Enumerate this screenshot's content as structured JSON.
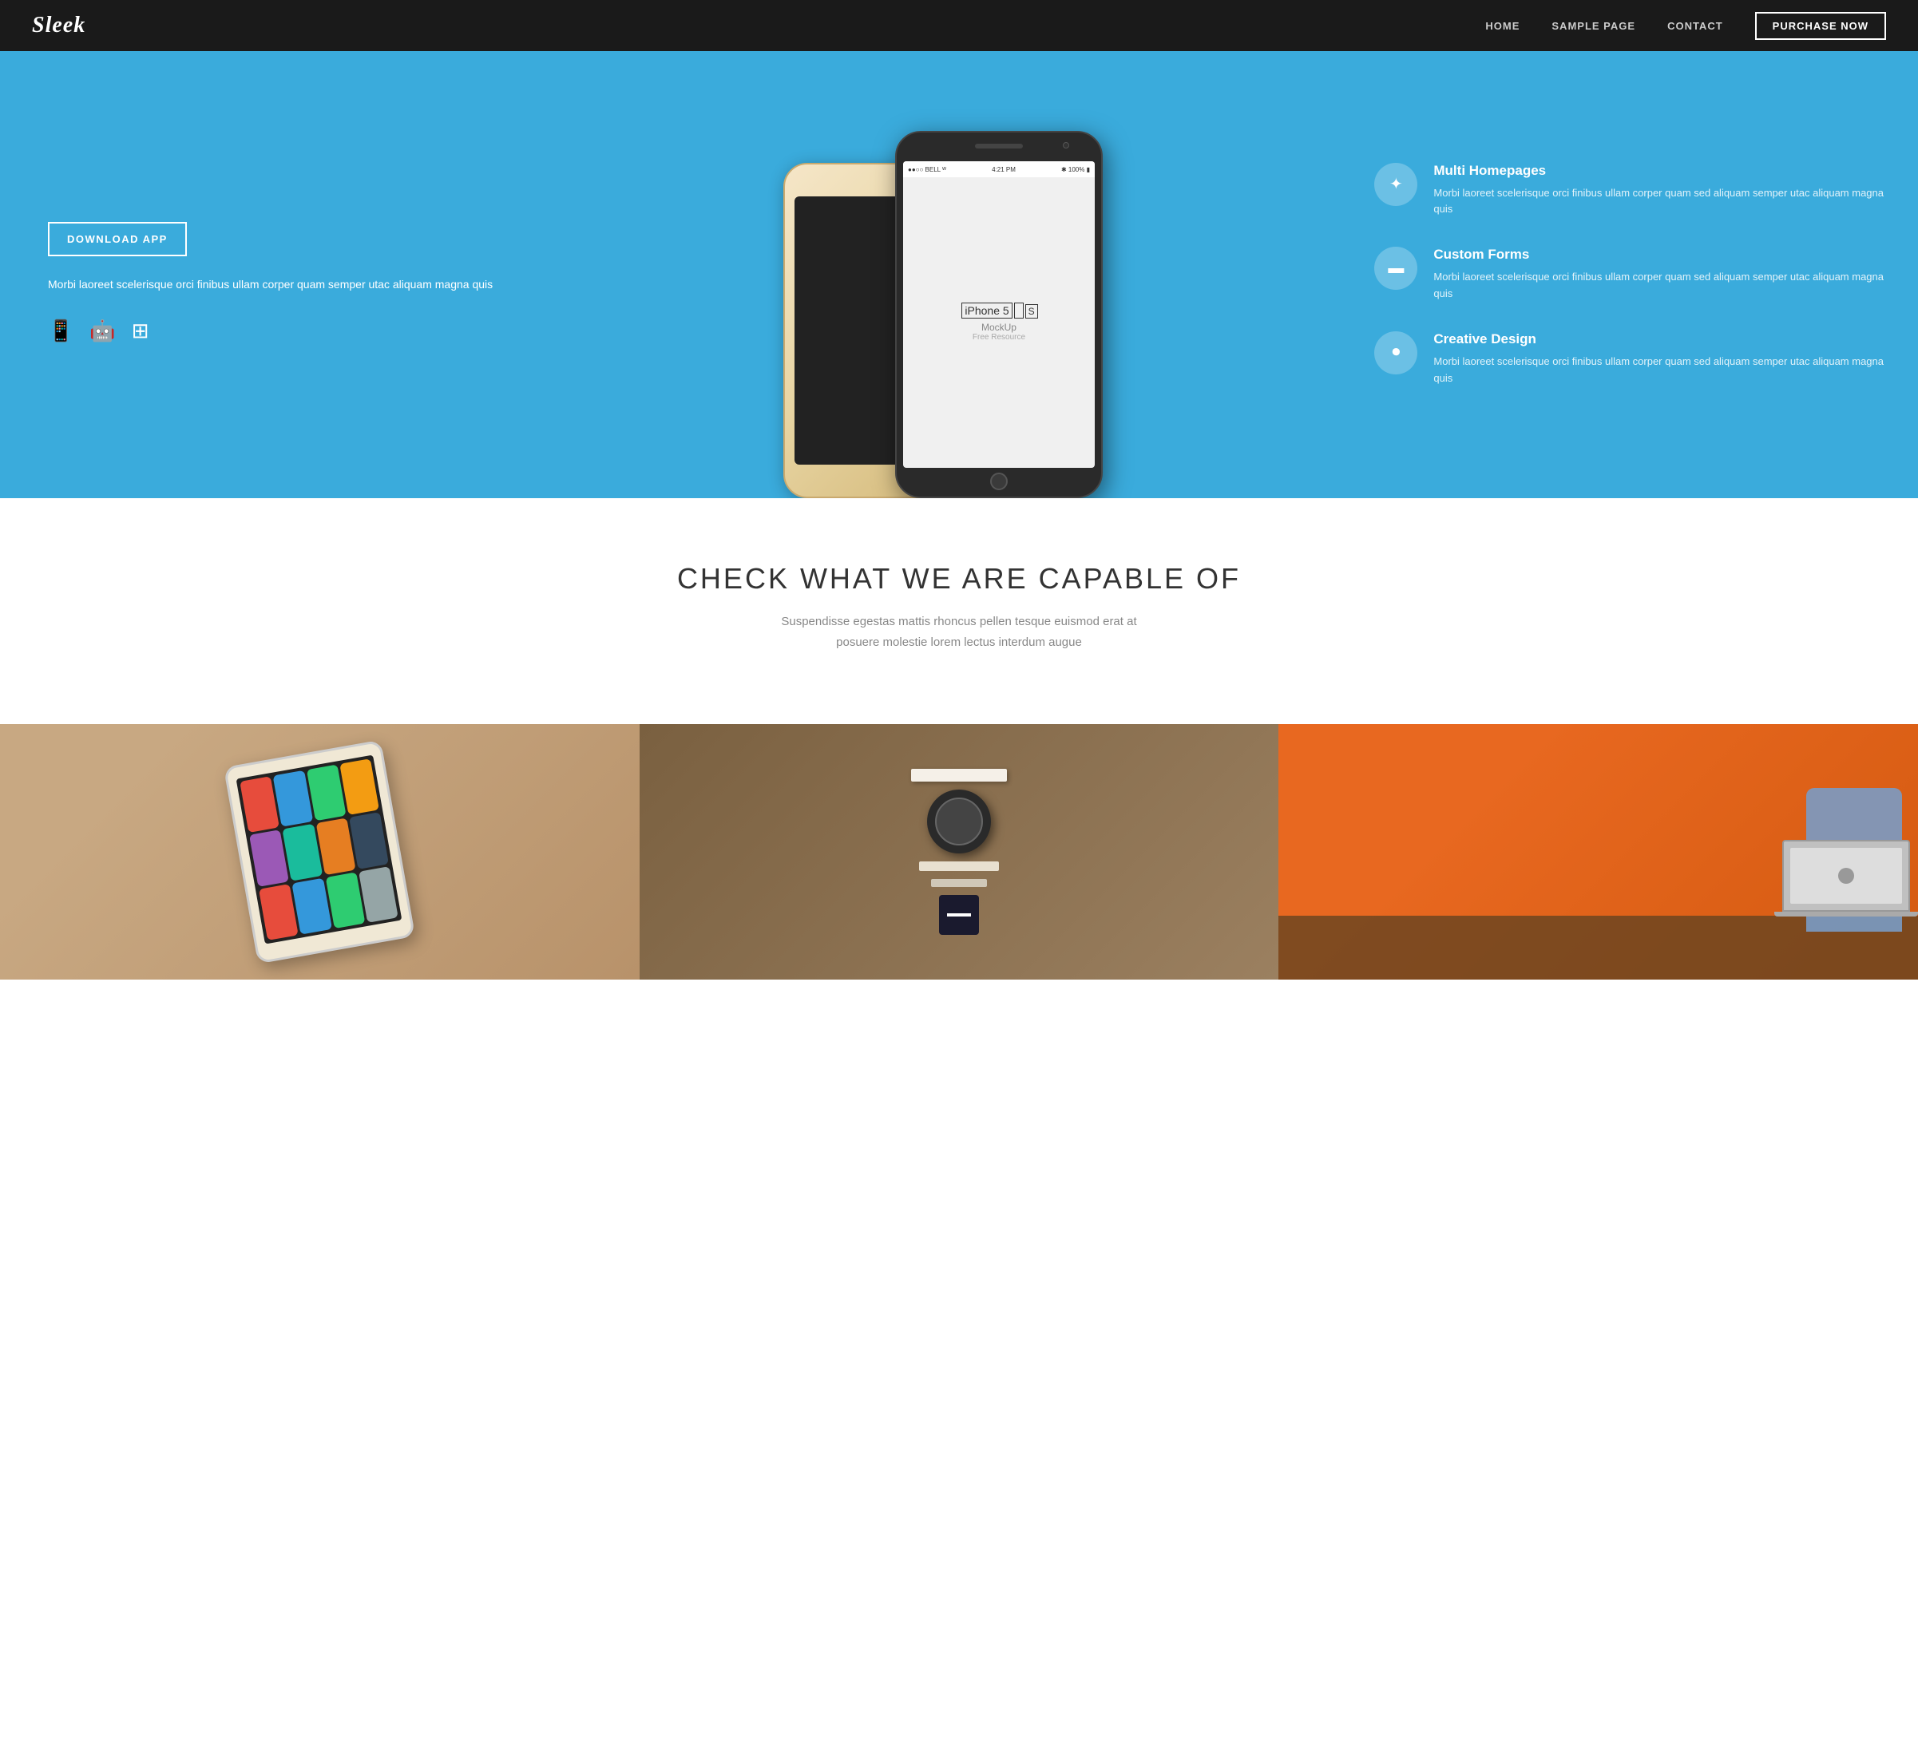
{
  "nav": {
    "logo": "Sleek",
    "links": [
      {
        "label": "HOME",
        "href": "#"
      },
      {
        "label": "SAMPLE PAGE",
        "href": "#"
      },
      {
        "label": "CONTACT",
        "href": "#"
      }
    ],
    "purchase_label": "PURCHASE NOW"
  },
  "hero": {
    "download_btn": "DOWNLOAD APP",
    "description": "Morbi laoreet scelerisque orci finibus ullam corper quam semper utac aliquam magna quis",
    "features": [
      {
        "title": "Multi Homepages",
        "description": "Morbi laoreet scelerisque orci finibus ullam corper quam sed aliquam semper utac aliquam magna quis",
        "icon": "✦"
      },
      {
        "title": "Custom Forms",
        "description": "Morbi laoreet scelerisque orci finibus ullam corper quam sed aliquam semper utac aliquam magna quis",
        "icon": "▬"
      },
      {
        "title": "Creative Design",
        "description": "Morbi laoreet scelerisque orci finibus ullam corper quam sed aliquam semper utac aliquam magna quis",
        "icon": "⏺"
      }
    ]
  },
  "capabilities": {
    "heading": "CHECK WHAT WE ARE CAPABLE OF",
    "description_line1": "Suspendisse egestas mattis rhoncus pellen tesque euismod erat at",
    "description_line2": "posuere molestie lorem lectus interdum augue"
  },
  "phone": {
    "model": "iPhone 5",
    "variant": "S",
    "mockup_label": "MockUp",
    "free_resource": "Free Resource",
    "status_left": "●●○○ BELL ᵂ",
    "status_time": "4:21 PM",
    "status_right": "✱ 100% ▮"
  }
}
